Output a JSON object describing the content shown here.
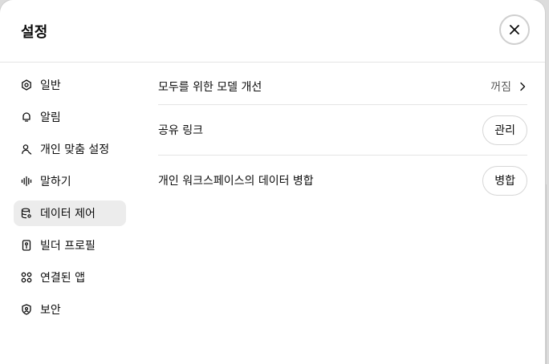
{
  "dialog": {
    "title": "설정"
  },
  "sidebar": {
    "items": [
      {
        "label": "일반",
        "icon": "gear-icon"
      },
      {
        "label": "알림",
        "icon": "bell-icon"
      },
      {
        "label": "개인 맞춤 설정",
        "icon": "person-icon"
      },
      {
        "label": "말하기",
        "icon": "waveform-icon"
      },
      {
        "label": "데이터 제어",
        "icon": "database-icon",
        "active": true
      },
      {
        "label": "빌더 프로필",
        "icon": "id-card-icon"
      },
      {
        "label": "연결된 앱",
        "icon": "apps-grid-icon"
      },
      {
        "label": "보안",
        "icon": "shield-icon"
      }
    ]
  },
  "content": {
    "rows": [
      {
        "label": "모두를 위한 모델 개선",
        "value": "꺼짐"
      },
      {
        "label": "공유 링크",
        "button": "관리"
      },
      {
        "label": "개인 워크스페이스의 데이터 병합",
        "button": "병합"
      }
    ]
  }
}
